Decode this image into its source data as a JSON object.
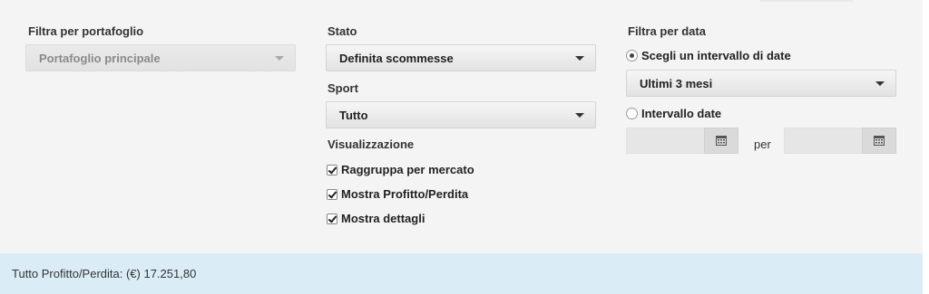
{
  "portfolio_filter": {
    "label": "Filtra per portafoglio",
    "selected": "Portafoglio principale"
  },
  "status": {
    "label": "Stato",
    "selected": "Definita scommesse"
  },
  "sport": {
    "label": "Sport",
    "selected": "Tutto"
  },
  "display": {
    "label": "Visualizzazione",
    "options": [
      {
        "label": "Raggruppa per mercato",
        "checked": true
      },
      {
        "label": "Mostra Profitto/Perdita",
        "checked": true
      },
      {
        "label": "Mostra dettagli",
        "checked": true
      }
    ]
  },
  "date_filter": {
    "label": "Filtra per data",
    "range_option_label": "Scegli un intervallo di date",
    "range_selected": "Ultimi 3 mesi",
    "custom_option_label": "Intervallo date",
    "from_value": "",
    "to_value": "",
    "separator": "per"
  },
  "footer": {
    "total_label": "Tutto Profitto/Perdita: (€) 17.251,80"
  }
}
